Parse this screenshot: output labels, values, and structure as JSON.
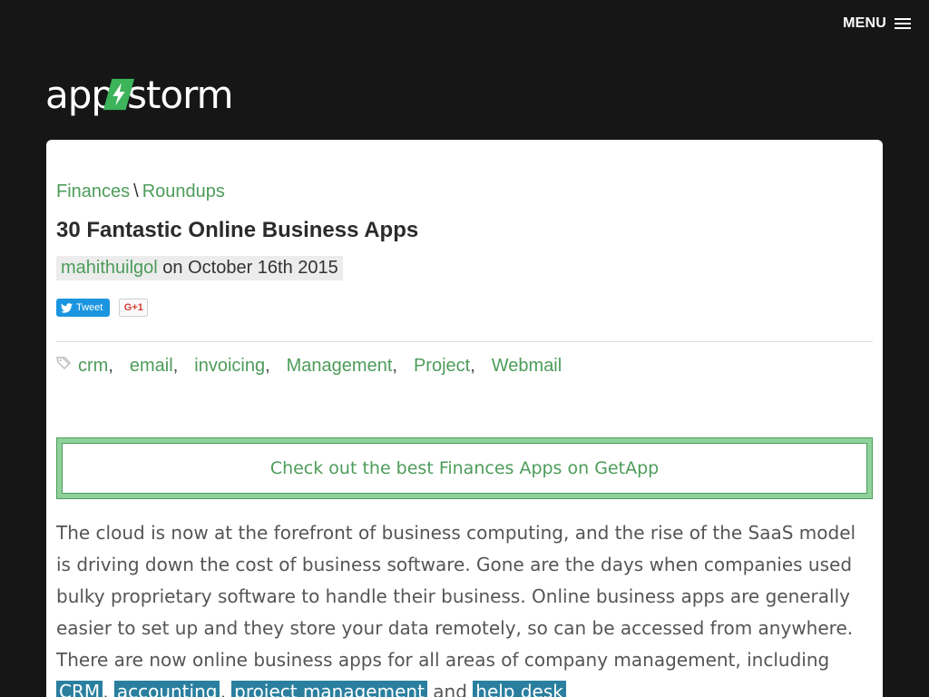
{
  "header": {
    "menu_label": "MENU",
    "logo_left": "app",
    "logo_right": "storm"
  },
  "breadcrumb": {
    "items": [
      {
        "label": "Finances"
      },
      {
        "label": "Roundups"
      }
    ],
    "separator": "\\"
  },
  "article": {
    "title": "30 Fantastic Online Business Apps",
    "author": "mahithuilgol",
    "date_text": "on October 16th 2015"
  },
  "social": {
    "tweet_label": "Tweet",
    "gplus_label": "G+1"
  },
  "tags": [
    {
      "label": "crm"
    },
    {
      "label": "email"
    },
    {
      "label": "invoicing"
    },
    {
      "label": "Management"
    },
    {
      "label": "Project"
    },
    {
      "label": "Webmail"
    }
  ],
  "cta": {
    "label": "Check out the best Finances Apps on GetApp"
  },
  "body": {
    "text": "The cloud is now at the forefront of business computing, and the rise of the SaaS model is driving down the cost of business software. Gone are the days when companies used bulky proprietary software to handle their business. Online business apps are generally easier to set up and they store your data remotely, so can be accessed from anywhere. There are now online business apps for all areas of company management, including",
    "links": [
      "CRM",
      "accounting",
      "project management",
      "help desk"
    ],
    "sep1": ", ",
    "sep2": ", ",
    "sep3": " and "
  },
  "colors": {
    "background": "#161616",
    "accent_green": "#4d9c5a",
    "cta_fill": "#8fd19a",
    "keyword_blue": "#2a7f9f",
    "tweet_blue": "#1b95e0",
    "bolt_green": "#3db35a"
  }
}
